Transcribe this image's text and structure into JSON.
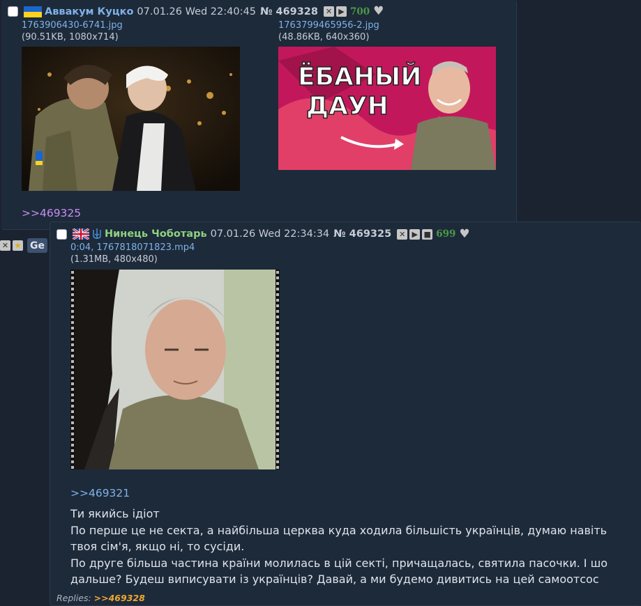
{
  "post1": {
    "author": "Аввакум Куцко",
    "date": "07.01.26 Wed 22:40:45",
    "number": "№ 469328",
    "count": "700",
    "files": [
      {
        "name": "1763906430-6741.jpg",
        "meta": "(90.51KB, 1080x714)"
      },
      {
        "name": "1763799465956-2.jpg",
        "meta": "(48.86KB, 640x360)",
        "overlay_line1": "ЁБАНЫЙ",
        "overlay_line2": "ДАУН"
      }
    ],
    "reply_link": ">>469325"
  },
  "side": {
    "partial_button": "Ge"
  },
  "post2": {
    "author": "Нинець Чоботарь",
    "date": "07.01.26 Wed 22:34:34",
    "number": "№ 469325",
    "count": "699",
    "file": {
      "name": "0:04, 1767818071823.mp4",
      "meta": "(1.31MB, 480x480)"
    },
    "reply_to": ">>469321",
    "message": [
      "Ти якийсь ідіот",
      "По перше це не секта, а найбільша церква куда ходила більшість українців, думаю навіть твоя сім'я, якщо ні, то сусіди.",
      "По друге більша частина країни молилась в цій секті, причащалась, святила пасочки. І шо дальше? Будеш виписувати із українців? Давай, а ми будемо дивитись на цей самоотсос"
    ],
    "replies_label": "Replies:",
    "replies_link": ">>469328"
  },
  "colors": {
    "background": "#1c2330",
    "post_bg": "#1d2a3a",
    "name_blue": "#7fb2e8",
    "name_green": "#8fd17f",
    "reply_link_purple": "#c98ef0",
    "count_green": "#4b9a45",
    "replies_orange": "#f0a830"
  }
}
